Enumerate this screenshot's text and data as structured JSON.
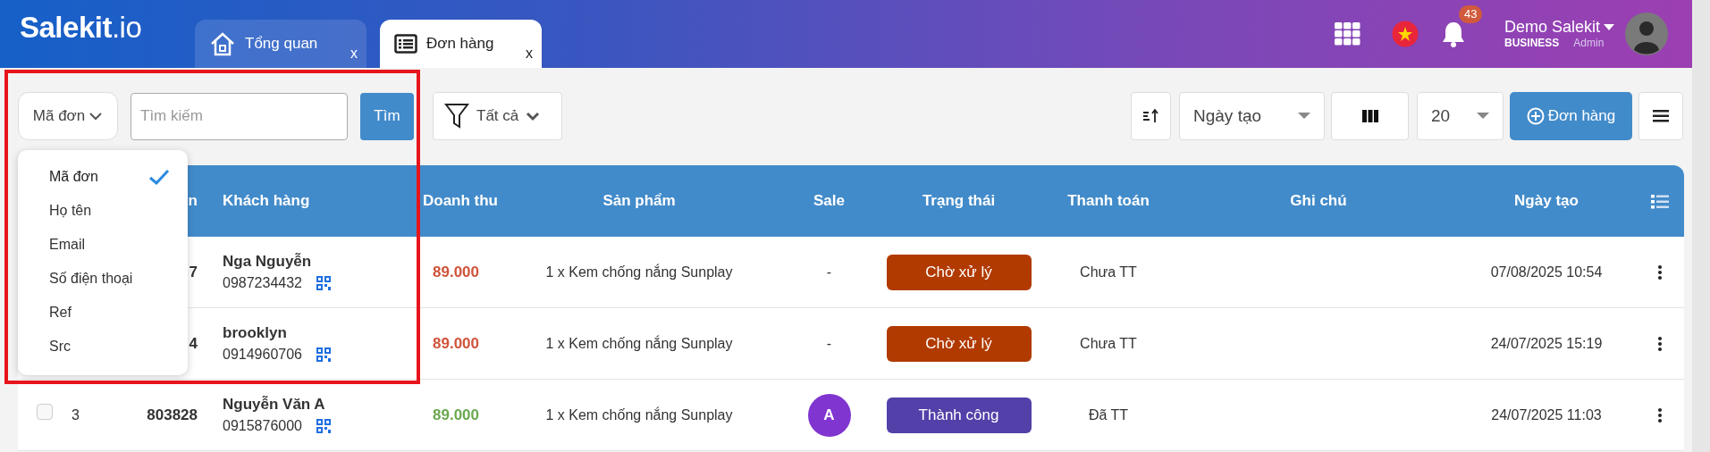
{
  "logo": "**Salekit**.io",
  "tabs": [
    {
      "label": "Tổng quan",
      "selected": false,
      "close": "x"
    },
    {
      "label": "Đơn hàng",
      "selected": true,
      "close": "x"
    }
  ],
  "user": {
    "name": "Demo Salekit",
    "plan": "BUSINESS",
    "role": "Admin",
    "notifications": "43"
  },
  "toolbar": {
    "search_by": "Mã đơn",
    "search": {
      "placeholder": "Tìm kiếm"
    },
    "search_button": "Tìm",
    "filter": "Tất cả",
    "sort_by": "Ngày tạo",
    "page_size": "20",
    "add_button": "Đơn hàng"
  },
  "search_by_menu": [
    {
      "label": "Mã đơn",
      "selected": true
    },
    {
      "label": "Họ tên",
      "selected": false
    },
    {
      "label": "Email",
      "selected": false
    },
    {
      "label": "Số điện thoại",
      "selected": false
    },
    {
      "label": "Ref",
      "selected": false
    },
    {
      "label": "Src",
      "selected": false
    }
  ],
  "table": {
    "columns": [
      "n",
      "Khách hàng",
      "Doanh thu",
      "Sản phẩm",
      "Sale",
      "Trạng thái",
      "Thanh toán",
      "Ghi chú",
      "Ngày tạo"
    ],
    "rows": [
      {
        "code": "7",
        "customer": "Nga Nguyễn",
        "phone": "0987234432",
        "revenue": {
          "text": "89.000",
          "color": "#d0533a"
        },
        "product": "1 x Kem chống nắng Sunplay",
        "sale": {
          "kind": "none",
          "text": "-"
        },
        "status": {
          "label": "Chờ xử lý",
          "color": "#b13a00"
        },
        "payment": "Chưa TT",
        "created": "07/08/2025 10:54"
      },
      {
        "code": "4",
        "customer": "brooklyn",
        "phone": "0914960706",
        "revenue": {
          "text": "89.000",
          "color": "#d0533a"
        },
        "product": "1 x Kem chống nắng Sunplay",
        "sale": {
          "kind": "none",
          "text": "-"
        },
        "status": {
          "label": "Chờ xử lý",
          "color": "#b13a00"
        },
        "payment": "Chưa TT",
        "created": "24/07/2025 15:19"
      },
      {
        "checked": false,
        "index": "3",
        "code": "803828",
        "customer": "Nguyễn Văn A",
        "phone": "0915876000",
        "revenue": {
          "text": "89.000",
          "color": "#6aa84f"
        },
        "product": "1 x Kem chống nắng Sunplay",
        "sale": {
          "kind": "avatar",
          "initial": "A"
        },
        "status": {
          "label": "Thành công",
          "color": "#5340a8"
        },
        "payment": "Đã TT",
        "created": "24/07/2025 11:03"
      }
    ]
  }
}
